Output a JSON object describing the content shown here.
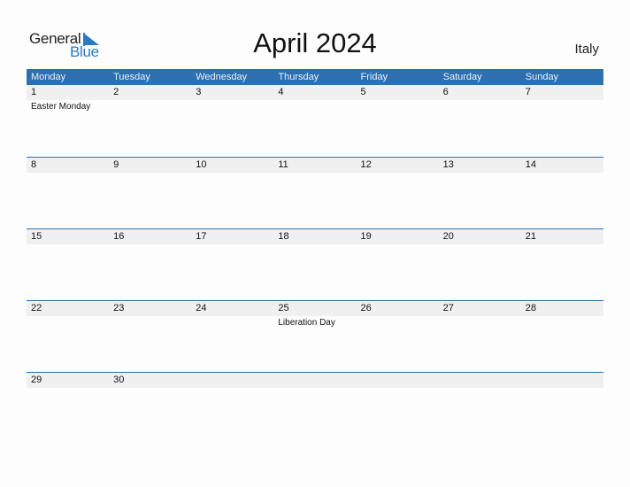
{
  "logo": {
    "word1": "General",
    "word2": "Blue"
  },
  "title": "April 2024",
  "country": "Italy",
  "colors": {
    "accent": "#2e6fb0",
    "date_strip": "#f0f0f0",
    "logo_blue": "#2a7ac0"
  },
  "weekdays": [
    "Monday",
    "Tuesday",
    "Wednesday",
    "Thursday",
    "Friday",
    "Saturday",
    "Sunday"
  ],
  "weeks": [
    {
      "days": [
        "1",
        "2",
        "3",
        "4",
        "5",
        "6",
        "7"
      ],
      "events": [
        "Easter Monday",
        "",
        "",
        "",
        "",
        "",
        ""
      ]
    },
    {
      "days": [
        "8",
        "9",
        "10",
        "11",
        "12",
        "13",
        "14"
      ],
      "events": [
        "",
        "",
        "",
        "",
        "",
        "",
        ""
      ]
    },
    {
      "days": [
        "15",
        "16",
        "17",
        "18",
        "19",
        "20",
        "21"
      ],
      "events": [
        "",
        "",
        "",
        "",
        "",
        "",
        ""
      ]
    },
    {
      "days": [
        "22",
        "23",
        "24",
        "25",
        "26",
        "27",
        "28"
      ],
      "events": [
        "",
        "",
        "",
        "Liberation Day",
        "",
        "",
        ""
      ]
    },
    {
      "days": [
        "29",
        "30",
        "",
        "",
        "",
        "",
        ""
      ],
      "events": [
        "",
        "",
        "",
        "",
        "",
        "",
        ""
      ]
    }
  ]
}
